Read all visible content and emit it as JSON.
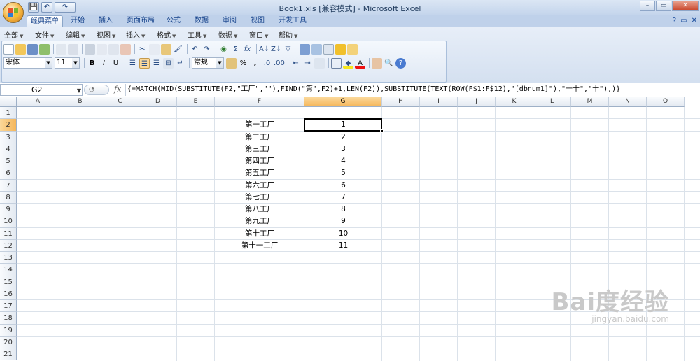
{
  "window": {
    "title": "Book1.xls  [兼容模式] - Microsoft Excel",
    "minimize": "–",
    "restore": "▭",
    "close": "✕"
  },
  "qat": [
    "💾",
    "↶",
    "↷"
  ],
  "ribbon_tabs": [
    "经典菜单",
    "开始",
    "插入",
    "页面布局",
    "公式",
    "数据",
    "审阅",
    "视图",
    "开发工具"
  ],
  "help_icons": [
    "?",
    "▭",
    "✕"
  ],
  "menus": [
    "全部",
    "文件",
    "编辑",
    "视图",
    "插入",
    "格式",
    "工具",
    "数据",
    "窗口",
    "帮助"
  ],
  "toolbar": {
    "font_name": "宋体",
    "font_size": "11",
    "bold": "B",
    "italic": "I",
    "underline": "U",
    "number_format": "常规",
    "percent": "%",
    "comma": ",",
    "sigma": "Σ",
    "fx": "fx",
    "font_color": "A"
  },
  "formula_bar": {
    "name_box": "G2",
    "fx_label": "fx",
    "formula": "{=MATCH(MID(SUBSTITUTE(F2,\"工厂\",\"\"),FIND(\"第\",F2)+1,LEN(F2)),SUBSTITUTE(TEXT(ROW(F$1:F$12),\"[dbnum1]\"),\"一十\",\"十\"),)}"
  },
  "columns": [
    "A",
    "B",
    "C",
    "D",
    "E",
    "F",
    "G",
    "H",
    "I",
    "J",
    "K",
    "L",
    "M",
    "N",
    "O"
  ],
  "rows": [
    "1",
    "2",
    "3",
    "4",
    "5",
    "6",
    "7",
    "8",
    "9",
    "10",
    "11",
    "12",
    "13",
    "14",
    "15",
    "16",
    "17",
    "18",
    "19",
    "20",
    "21"
  ],
  "selected_cell": "G2",
  "data": {
    "F": [
      "第一工厂",
      "第二工厂",
      "第三工厂",
      "第四工厂",
      "第五工厂",
      "第六工厂",
      "第七工厂",
      "第八工厂",
      "第九工厂",
      "第十工厂",
      "第十一工厂"
    ],
    "G": [
      "1",
      "2",
      "3",
      "4",
      "5",
      "6",
      "7",
      "8",
      "9",
      "10",
      "11"
    ]
  },
  "watermark": {
    "main": "Bai度经验",
    "sub": "jingyan.baidu.com"
  }
}
